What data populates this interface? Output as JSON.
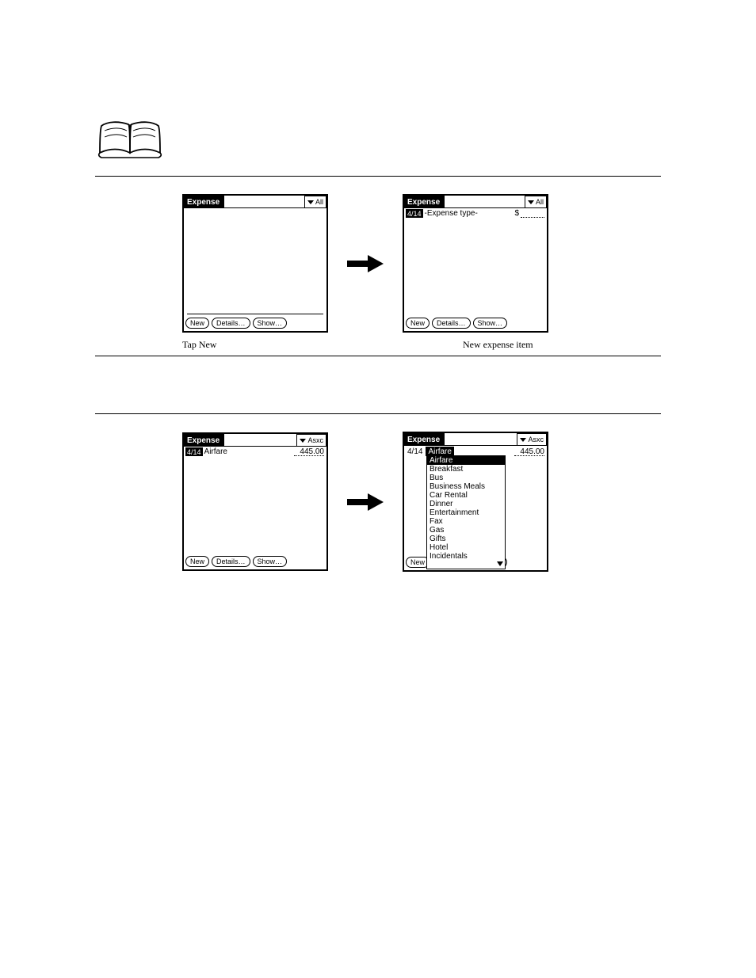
{
  "title_label": "Expense",
  "category_all": "All",
  "category_asxc": "Asxc",
  "buttons": {
    "new": "New",
    "details": "Details…",
    "show": "Show…"
  },
  "row_date": "4/14",
  "row_type_placeholder": "-Expense type-",
  "row_dollar": "$",
  "row_type_airfare": "Airfare",
  "row_amount": "445.00",
  "captions": {
    "left1": "Tap New",
    "right1": "New expense item"
  },
  "expense_types": [
    "Airfare",
    "Breakfast",
    "Bus",
    "Business Meals",
    "Car Rental",
    "Dinner",
    "Entertainment",
    "Fax",
    "Gas",
    "Gifts",
    "Hotel",
    "Incidentals"
  ]
}
